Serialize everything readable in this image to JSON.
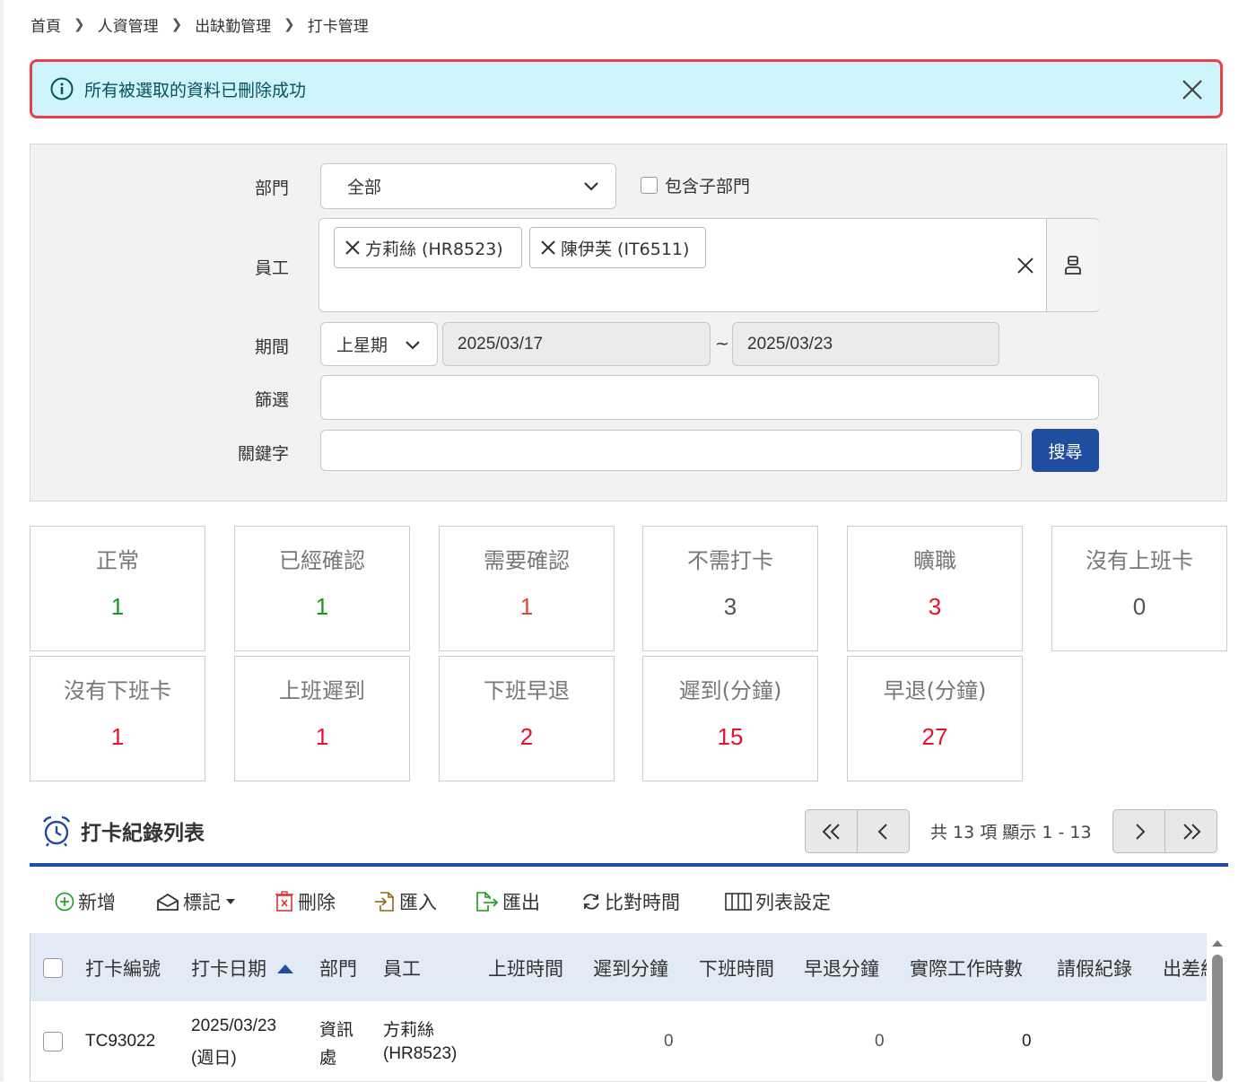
{
  "breadcrumb": [
    "首頁",
    "人資管理",
    "出缺勤管理",
    "打卡管理"
  ],
  "alert": {
    "message": "所有被選取的資料已刪除成功"
  },
  "filter": {
    "department_label": "部門",
    "department_value": "全部",
    "include_sub_label": "包含子部門",
    "employee_label": "員工",
    "employees": [
      "方莉絲 (HR8523)",
      "陳伊芙 (IT6511)"
    ],
    "period_label": "期間",
    "period_value": "上星期",
    "date_from": "2025/03/17",
    "date_sep": "~",
    "date_to": "2025/03/23",
    "screen_label": "篩選",
    "keyword_label": "關鍵字",
    "search_button": "搜尋"
  },
  "stats": [
    {
      "title": "正常",
      "value": "1",
      "color": "#1a9a1a"
    },
    {
      "title": "已經確認",
      "value": "1",
      "color": "#1a9a1a"
    },
    {
      "title": "需要確認",
      "value": "1",
      "color": "#e0443a"
    },
    {
      "title": "不需打卡",
      "value": "3",
      "color": "#555555"
    },
    {
      "title": "曠職",
      "value": "3",
      "color": "#e8132a"
    },
    {
      "title": "沒有上班卡",
      "value": "0",
      "color": "#555555"
    },
    {
      "title": "沒有下班卡",
      "value": "1",
      "color": "#e8132a"
    },
    {
      "title": "上班遲到",
      "value": "1",
      "color": "#e8132a"
    },
    {
      "title": "下班早退",
      "value": "2",
      "color": "#e8132a"
    },
    {
      "title": "遲到(分鐘)",
      "value": "15",
      "color": "#e8132a"
    },
    {
      "title": "早退(分鐘)",
      "value": "27",
      "color": "#e8132a"
    }
  ],
  "list": {
    "title": "打卡紀錄列表",
    "pager_text": "共 13 項 顯示 1 - 13"
  },
  "toolbar": {
    "add": "新增",
    "mark": "標記",
    "delete": "刪除",
    "import": "匯入",
    "export": "匯出",
    "compare": "比對時間",
    "columns": "列表設定"
  },
  "table": {
    "headers": [
      "打卡編號",
      "打卡日期",
      "部門",
      "員工",
      "上班時間",
      "遲到分鐘",
      "下班時間",
      "早退分鐘",
      "實際工作時數",
      "請假紀錄",
      "出差紀錄"
    ],
    "rows": [
      {
        "id": "TC93022",
        "date": "2025/03/23",
        "weekday": "(週日)",
        "dept_line1": "資訊",
        "dept_line2": "處",
        "emp_line1": "方莉絲",
        "emp_line2": "(HR8523)",
        "late_min": "0",
        "early_min": "0",
        "work_hours": "0"
      }
    ]
  }
}
